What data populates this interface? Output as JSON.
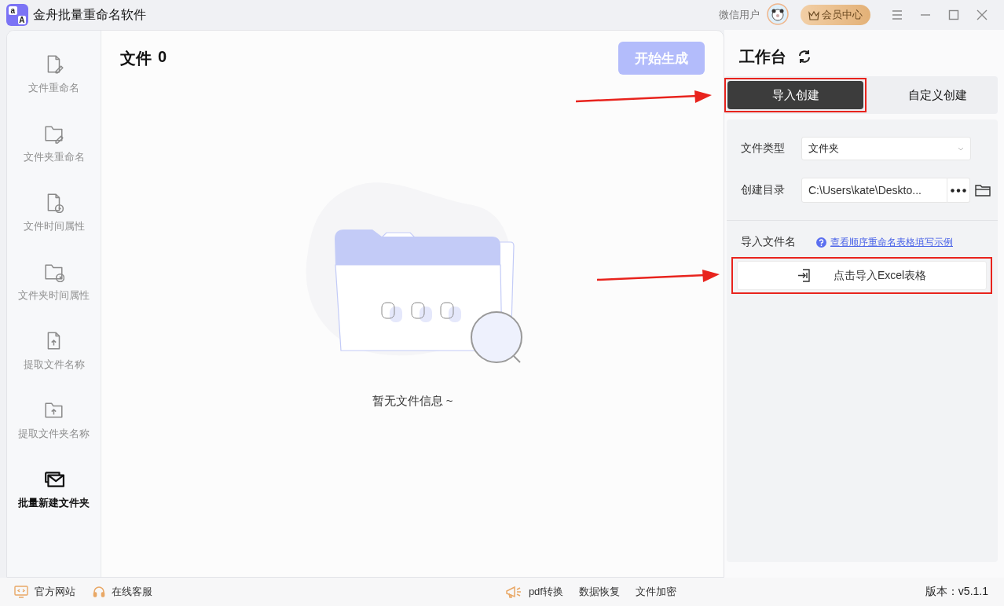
{
  "window": {
    "title": "金舟批量重命名软件",
    "logo": {
      "small": "a",
      "large": "A"
    },
    "user_name": "微信用户",
    "member_button": "会员中心"
  },
  "sidebar": {
    "items": [
      {
        "label": "文件重命名",
        "selected": false
      },
      {
        "label": "文件夹重命名",
        "selected": false
      },
      {
        "label": "文件时间属性",
        "selected": false
      },
      {
        "label": "文件夹时间属性",
        "selected": false
      },
      {
        "label": "提取文件名称",
        "selected": false
      },
      {
        "label": "提取文件夹名称",
        "selected": false
      },
      {
        "label": "批量新建文件夹",
        "selected": true
      }
    ]
  },
  "file_panel": {
    "title": "文件",
    "count": "0",
    "start_button": {
      "label": "开始生成",
      "disabled": true
    },
    "empty_message": "暂无文件信息 ~"
  },
  "workbench": {
    "title": "工作台",
    "tabs": [
      {
        "label": "导入创建",
        "selected": true,
        "highlighted": true
      },
      {
        "label": "自定义创建",
        "selected": false,
        "highlighted": false
      }
    ],
    "file_type": {
      "label": "文件类型",
      "value": "文件夹"
    },
    "directory": {
      "label": "创建目录",
      "value": "C:\\Users\\kate\\Deskto..."
    },
    "import_name": {
      "label": "导入文件名",
      "help_link": "查看顺序重命名表格填写示例"
    },
    "import_button": {
      "label": "点击导入Excel表格",
      "highlighted": true
    }
  },
  "status_bar": {
    "left_links": [
      "官方网站",
      "在线客服"
    ],
    "tools": [
      "pdf转换",
      "数据恢复",
      "文件加密"
    ],
    "version": "版本：v5.1.1"
  }
}
